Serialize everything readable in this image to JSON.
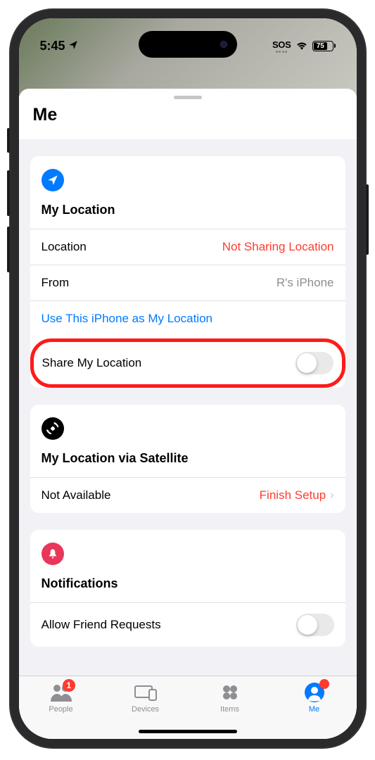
{
  "status": {
    "time": "5:45",
    "sos": "SOS",
    "battery": "75"
  },
  "sheet": {
    "title": "Me"
  },
  "card_location": {
    "icon": "navigation-icon",
    "heading": "My Location",
    "rows": {
      "location_label": "Location",
      "location_value": "Not Sharing Location",
      "from_label": "From",
      "from_value": "R's iPhone",
      "use_this": "Use This iPhone as My Location",
      "share_label": "Share My Location"
    }
  },
  "card_satellite": {
    "icon": "satellite-icon",
    "heading": "My Location via Satellite",
    "status": "Not Available",
    "action": "Finish Setup"
  },
  "card_notifications": {
    "icon": "bell-icon",
    "heading": "Notifications",
    "allow_label": "Allow Friend Requests"
  },
  "tabs": {
    "people": {
      "label": "People",
      "badge": "1"
    },
    "devices": {
      "label": "Devices"
    },
    "items": {
      "label": "Items"
    },
    "me": {
      "label": "Me"
    }
  }
}
